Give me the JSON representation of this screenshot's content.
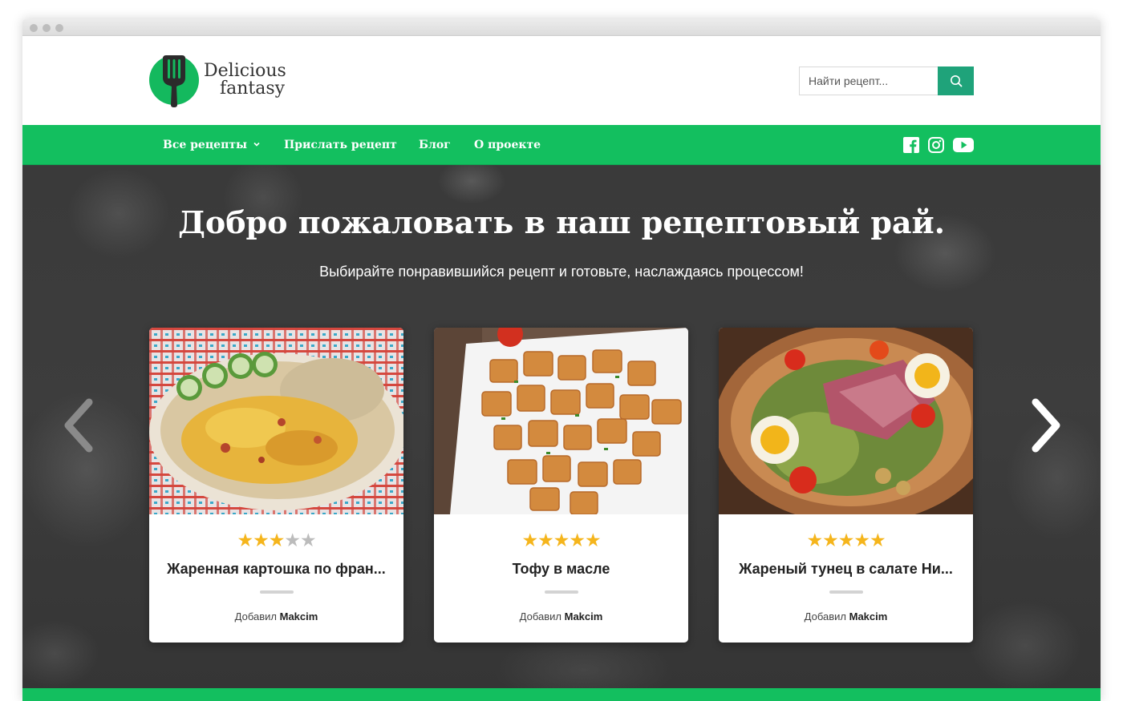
{
  "site": {
    "logo_line1": "Delicious",
    "logo_line2": "fantasy",
    "brand_color": "#13bf5f"
  },
  "search": {
    "placeholder": "Найти рецепт...",
    "button_icon": "search-icon"
  },
  "nav": {
    "items": [
      {
        "label": "Все рецепты",
        "has_dropdown": true
      },
      {
        "label": "Прислать рецепт"
      },
      {
        "label": "Блог"
      },
      {
        "label": "О проекте"
      }
    ],
    "social": [
      "facebook-icon",
      "instagram-icon",
      "youtube-icon"
    ]
  },
  "hero": {
    "title": "Добро пожаловать в наш рецептовый рай.",
    "subtitle": "Выбирайте понравившийся рецепт и готовьте, наслаждаясь процессом!"
  },
  "carousel": {
    "prev_icon": "chevron-left-icon",
    "next_icon": "chevron-right-icon",
    "cards": [
      {
        "title": "Жаренная картошка по фран...",
        "rating": 3,
        "max_rating": 5,
        "author_prefix": "Добавил",
        "author": "Makcim"
      },
      {
        "title": "Тофу в масле",
        "rating": 5,
        "max_rating": 5,
        "author_prefix": "Добавил",
        "author": "Makcim"
      },
      {
        "title": "Жареный тунец в салате Ни...",
        "rating": 5,
        "max_rating": 5,
        "author_prefix": "Добавил",
        "author": "Makcim"
      }
    ]
  },
  "colors": {
    "accent": "#13bf5f",
    "search_button": "#1fa37a",
    "star": "#f5b51c",
    "star_empty": "#bcbcbc"
  }
}
